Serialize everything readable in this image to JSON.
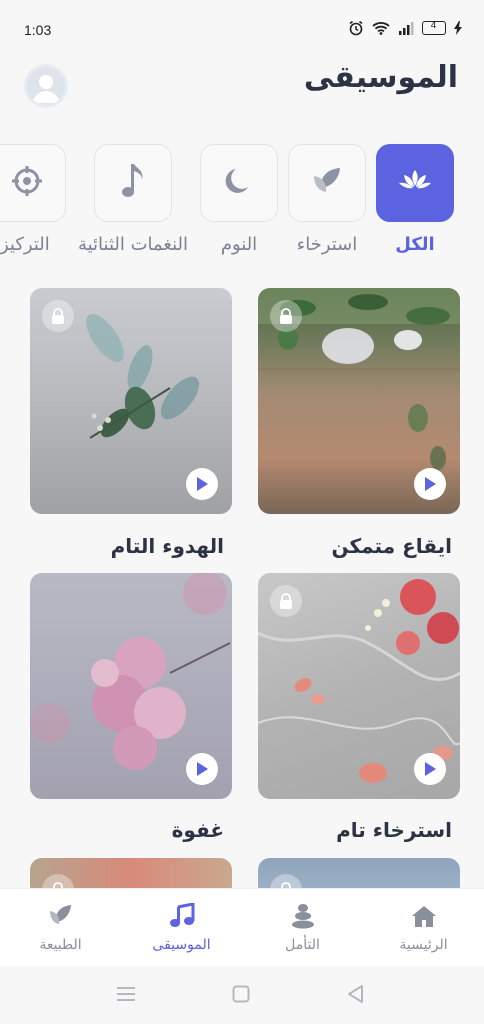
{
  "status": {
    "time": "1:03",
    "battery": "4"
  },
  "header": {
    "title": "الموسيقى"
  },
  "categories": [
    {
      "label": "الكل",
      "icon": "lotus-icon",
      "active": true
    },
    {
      "label": "استرخاء",
      "icon": "leaf-icon",
      "active": false
    },
    {
      "label": "النوم",
      "icon": "moon-icon",
      "active": false
    },
    {
      "label": "النغمات الثنائية",
      "icon": "music-note-icon",
      "active": false
    },
    {
      "label": "التركيز",
      "icon": "target-icon",
      "active": false
    }
  ],
  "tracks": [
    {
      "title": "ايقاع متمكن"
    },
    {
      "title": "الهدوء التام"
    },
    {
      "title": "استرخاء تام"
    },
    {
      "title": "غفوة"
    }
  ],
  "nav": {
    "home": "الرئيسية",
    "meditation": "التأمل",
    "music": "الموسيقى",
    "nature": "الطبيعة"
  },
  "colors": {
    "accent": "#5b63e0",
    "text": "#2d3344",
    "muted": "#7c8194"
  }
}
